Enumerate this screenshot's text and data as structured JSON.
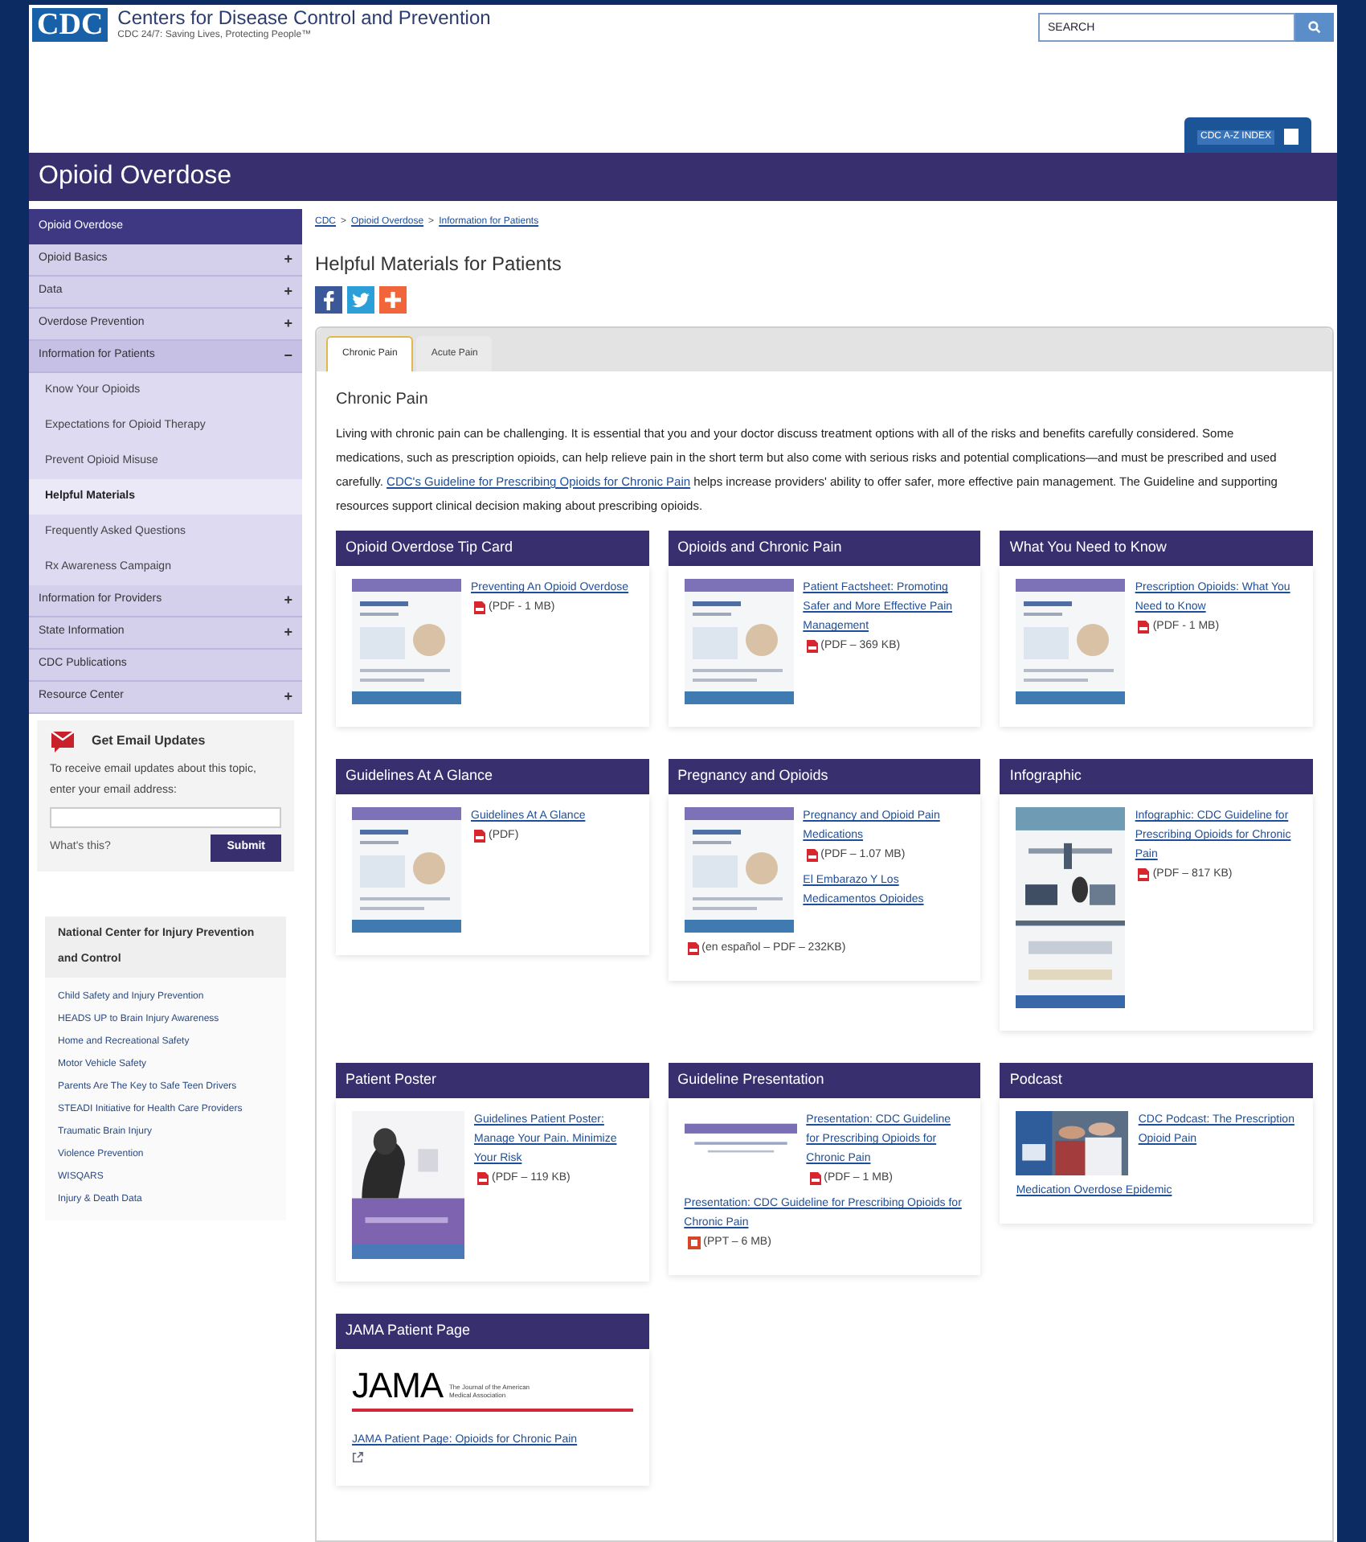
{
  "header": {
    "logo": "CDC",
    "agency": "Centers for Disease Control and Prevention",
    "tagline": "CDC 24/7: Saving Lives, Protecting People™",
    "search": {
      "placeholder": "SEARCH"
    },
    "index_button": "CDC A-Z INDEX"
  },
  "site_title": "Opioid Overdose",
  "sidebar": {
    "items": [
      {
        "label": "Opioid Overdose",
        "kind": "header",
        "selected": false
      },
      {
        "label": "Opioid Basics",
        "kind": "section",
        "toggle": "+",
        "expanded": false,
        "selected": false
      },
      {
        "label": "Data",
        "kind": "section",
        "toggle": "+",
        "expanded": false,
        "selected": false
      },
      {
        "label": "Overdose Prevention",
        "kind": "section",
        "toggle": "+",
        "expanded": false,
        "selected": false
      },
      {
        "label": "Information for Patients",
        "kind": "section",
        "toggle": "−",
        "expanded": true,
        "selected": false,
        "children": [
          {
            "label": "Know Your Opioids",
            "selected": false
          },
          {
            "label": "Expectations for Opioid Therapy",
            "selected": false
          },
          {
            "label": "Prevent Opioid Misuse",
            "selected": false
          },
          {
            "label": "Helpful Materials",
            "selected": true
          },
          {
            "label": "Frequently Asked Questions",
            "selected": false
          },
          {
            "label": "Rx Awareness Campaign",
            "selected": false
          }
        ]
      },
      {
        "label": "Information for Providers",
        "kind": "section",
        "toggle": "+",
        "expanded": false,
        "selected": false
      },
      {
        "label": "State Information",
        "kind": "section",
        "toggle": "+",
        "expanded": false,
        "selected": false
      },
      {
        "label": "CDC Publications",
        "kind": "section",
        "expanded": false,
        "selected": false
      },
      {
        "label": "Resource Center",
        "kind": "section",
        "toggle": "+",
        "expanded": false,
        "selected": false
      }
    ],
    "email_box": {
      "title": "Get Email Updates",
      "text": "To receive email updates about this topic, enter your email address:",
      "help_link": "What's this?",
      "submit": "Submit"
    },
    "center_box": {
      "title": "National Center for Injury Prevention and Control",
      "links": [
        "Child Safety and Injury Prevention",
        "HEADS UP to Brain Injury Awareness",
        "Home and Recreational Safety",
        "Motor Vehicle Safety",
        "Parents Are The Key to Safe Teen Drivers",
        "STEADI Initiative for Health Care Providers",
        "Traumatic Brain Injury",
        "Violence Prevention",
        "WISQARS",
        "Injury & Death Data"
      ]
    }
  },
  "breadcrumb": [
    "CDC",
    "Opioid Overdose",
    "Information for Patients"
  ],
  "breadcrumb_separator": ">",
  "page_title": "Helpful Materials for Patients",
  "share": [
    {
      "kind": "facebook"
    },
    {
      "kind": "twitter"
    },
    {
      "kind": "addthis"
    }
  ],
  "tabs": [
    {
      "label": "Chronic Pain",
      "selected": true
    },
    {
      "label": "Acute Pain",
      "selected": false
    }
  ],
  "panel": {
    "heading": "Chronic Pain",
    "paragraph": {
      "before": "Living with chronic pain can be challenging. It is essential that you and your doctor discuss treatment options with all of the risks and benefits carefully considered. Some medications, such as prescription opioids, can help relieve pain in the short term but also come with serious risks and potential complications—and must be prescribed and used carefully. ",
      "link": "CDC's Guideline for Prescribing Opioids for Chronic Pain",
      "after": " helps increase providers' ability to offer safer, more effective pain management. The Guideline and supporting resources support clinical decision making about prescribing opioids."
    },
    "cards": [
      {
        "title": "Opioid Overdose Tip Card",
        "thumbnail": {
          "kind": "picture"
        },
        "links": [
          {
            "text": "Preventing An Opioid Overdose",
            "file": {
              "kind": "pdf",
              "text": "(PDF - 1 MB)"
            }
          }
        ]
      },
      {
        "title": "Opioids and Chronic Pain",
        "thumbnail": {
          "kind": "picture"
        },
        "links": [
          {
            "text": "Patient Factsheet: Promoting Safer and More Effective Pain Management",
            "file": {
              "kind": "pdf",
              "text": "(PDF – 369 KB)"
            }
          }
        ]
      },
      {
        "title": "What You Need to Know",
        "thumbnail": {
          "kind": "picture"
        },
        "links": [
          {
            "text": "Prescription Opioids: What You Need to Know",
            "file": {
              "kind": "pdf",
              "text": "(PDF - 1 MB)"
            }
          }
        ]
      },
      {
        "title": "Guidelines At A Glance",
        "thumbnail": {
          "kind": "picture"
        },
        "links": [
          {
            "text": "Guidelines At A Glance",
            "file": {
              "kind": "pdf",
              "text": "(PDF)"
            }
          }
        ]
      },
      {
        "title": "Pregnancy and Opioids",
        "thumbnail": {
          "kind": "picture"
        },
        "links": [
          {
            "text": "Pregnancy and Opioid Pain Medications",
            "file": {
              "kind": "pdf",
              "text": "(PDF – 1.07 MB)"
            }
          },
          {
            "text": "El Embarazo Y Los Medicamentos Opioides"
          }
        ],
        "below": [
          {
            "file": {
              "kind": "pdf",
              "text": "(en español – PDF – 232KB)"
            }
          }
        ]
      },
      {
        "title": "Infographic",
        "thumbnail": {
          "kind": "picture"
        },
        "links": [
          {
            "text": "Infographic: CDC Guideline for Prescribing Opioids for Chronic Pain",
            "file": {
              "kind": "pdf",
              "text": "(PDF – 817 KB)"
            }
          }
        ]
      },
      {
        "title": "Patient Poster",
        "thumbnail": {
          "kind": "picture"
        },
        "links": [
          {
            "text": "Guidelines Patient Poster: Manage Your Pain. Minimize Your Risk",
            "file": {
              "kind": "pdf",
              "text": "(PDF – 119 KB)"
            }
          }
        ]
      },
      {
        "title": "Guideline Presentation",
        "thumbnail": {
          "kind": "picture"
        },
        "links": [
          {
            "text": "Presentation: CDC Guideline for Prescribing Opioids for Chronic Pain",
            "file": {
              "kind": "pdf",
              "text": "(PDF – 1 MB)"
            }
          }
        ],
        "below": [
          {
            "text": "Presentation: CDC Guideline for Prescribing Opioids for Chronic Pain",
            "file": {
              "kind": "ppt",
              "text": "(PPT – 6 MB)"
            }
          }
        ]
      },
      {
        "title": "Podcast",
        "thumbnail": {
          "kind": "picture"
        },
        "links": [
          {
            "text": "CDC Podcast: The Prescription Opioid Pain"
          }
        ],
        "below": [
          {
            "text": "Medication Overdose Epidemic"
          }
        ]
      },
      {
        "title": "JAMA Patient Page",
        "logo": {
          "mark": "JAMA",
          "caption": "The Journal of the American Medical Association"
        },
        "below": [
          {
            "text": "JAMA Patient Page: Opioids for Chronic Pain",
            "external": true
          }
        ]
      }
    ]
  }
}
